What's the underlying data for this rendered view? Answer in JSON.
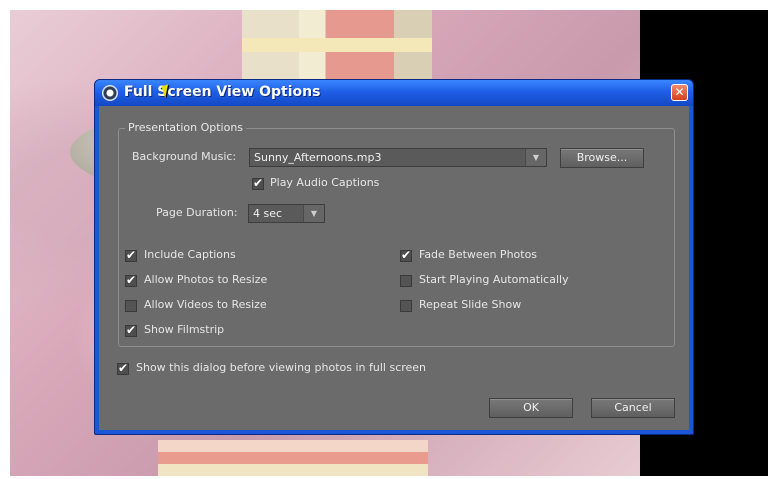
{
  "dialog": {
    "title": "Full Screen View Options",
    "close_label": "✕"
  },
  "presentation": {
    "legend": "Presentation Options",
    "background_music_label": "Background Music:",
    "background_music_value": "Sunny_Afternoons.mp3",
    "browse_label": "Browse...",
    "play_audio_captions_label": "Play Audio Captions",
    "play_audio_captions_checked": true,
    "page_duration_label": "Page Duration:",
    "page_duration_value": "4 sec",
    "options_left": [
      {
        "label": "Include Captions",
        "checked": true
      },
      {
        "label": "Allow Photos to Resize",
        "checked": true
      },
      {
        "label": "Allow Videos to Resize",
        "checked": false
      },
      {
        "label": "Show Filmstrip",
        "checked": true
      }
    ],
    "options_right": [
      {
        "label": "Fade Between Photos",
        "checked": true
      },
      {
        "label": "Start Playing Automatically",
        "checked": false
      },
      {
        "label": "Repeat Slide Show",
        "checked": false
      }
    ]
  },
  "show_dialog_label": "Show this dialog before viewing photos in full screen",
  "show_dialog_checked": true,
  "buttons": {
    "ok": "OK",
    "cancel": "Cancel"
  },
  "colors": {
    "titlebar": "#1f5fe6",
    "client_bg": "#6b6b6b",
    "close_button": "#d4401c"
  }
}
